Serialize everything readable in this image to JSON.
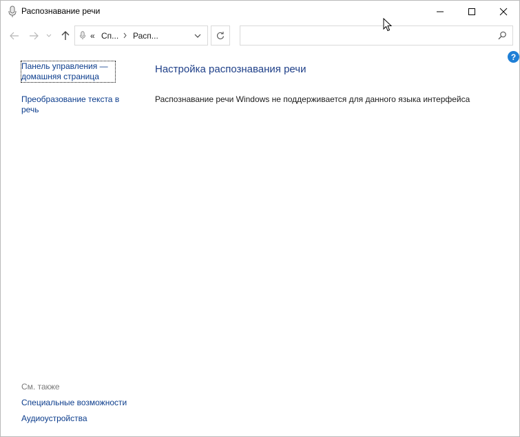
{
  "window": {
    "title": "Распознавание речи",
    "app_icon": "microphone-icon"
  },
  "caption_buttons": {
    "minimize": "minimize-icon",
    "maximize": "maximize-icon",
    "close": "close-icon"
  },
  "nav": {
    "back": "arrow-left-icon",
    "forward": "arrow-right-icon",
    "recent": "chevron-down-icon",
    "up": "arrow-up-icon",
    "breadcrumb_overflow": "«",
    "crumb_1": "Сп...",
    "crumb_2": "Расп...",
    "search_placeholder": ""
  },
  "left_pane": {
    "home_link": "Панель управления — домашняя страница",
    "tts_link": "Преобразование текста в речь",
    "see_also_label": "См. также",
    "see_also_links": [
      "Специальные возможности",
      "Аудиоустройства"
    ]
  },
  "content": {
    "heading": "Настройка распознавания речи",
    "message": "Распознавание речи Windows не поддерживается для данного языка интерфейса"
  },
  "colors": {
    "link": "#0b3c8c",
    "heading": "#1e3f88",
    "help_badge": "#1e7fd6"
  }
}
